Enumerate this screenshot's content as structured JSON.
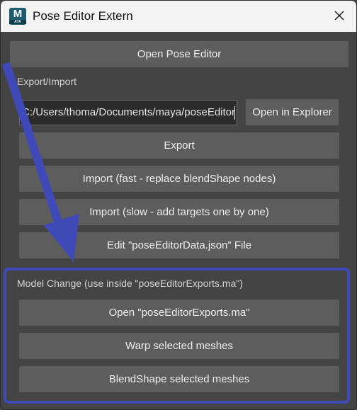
{
  "window": {
    "title": "Pose Editor Extern",
    "app_icon": {
      "letter": "M",
      "sub": "AYA",
      "name": "maya-app-icon"
    },
    "close_icon": "close-icon"
  },
  "main": {
    "open_pose_editor_label": "Open Pose Editor",
    "export_import_heading": "Export/Import",
    "path_value": "C:/Users/thoma/Documents/maya/poseEditor",
    "open_in_explorer_label": "Open in Explorer",
    "export_label": "Export",
    "import_fast_label": "Import (fast - replace blendShape nodes)",
    "import_slow_label": "Import (slow - add targets one by one)",
    "edit_file_label": "Edit \"poseEditorData.json\" File"
  },
  "model_change": {
    "heading": "Model Change (use inside \"poseEditorExports.ma\")",
    "open_exports_label": "Open \"poseEditorExports.ma\"",
    "warp_label": "Warp selected meshes",
    "blendshape_label": "BlendShape selected meshes"
  },
  "annotation": {
    "color": "#3f4ab8",
    "arrow_icon": "annotation-arrow"
  }
}
